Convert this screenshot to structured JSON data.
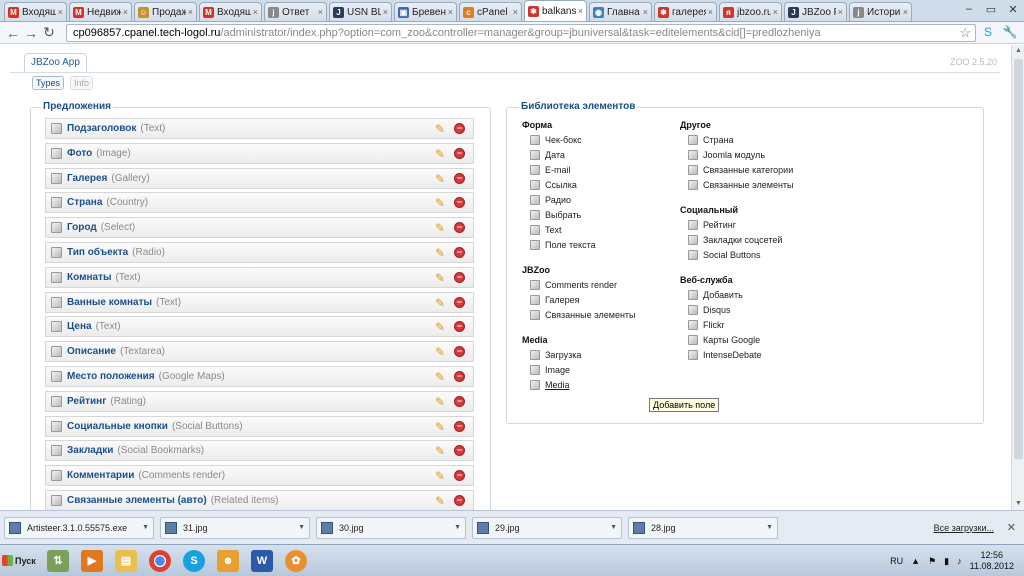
{
  "browser": {
    "tabs": [
      {
        "label": "Входящ",
        "icon": "M",
        "color": "#d93025"
      },
      {
        "label": "Недвиж",
        "icon": "M",
        "color": "#d93025"
      },
      {
        "label": "Продаж",
        "icon": "☺",
        "color": "#c8902a"
      },
      {
        "label": "Входящ",
        "icon": "M",
        "color": "#d93025"
      },
      {
        "label": "Ответ",
        "icon": "j",
        "color": "#888888"
      },
      {
        "label": "USN BL",
        "icon": "J",
        "color": "#2a3a5a"
      },
      {
        "label": "Бревен",
        "icon": "▣",
        "color": "#3a6ab0"
      },
      {
        "label": "cPanel F",
        "icon": "c",
        "color": "#e27b1f"
      },
      {
        "label": "balkans",
        "icon": "✱",
        "color": "#d0342c"
      },
      {
        "label": "Главна",
        "icon": "◉",
        "color": "#3a80c2"
      },
      {
        "label": "галерея",
        "icon": "✱",
        "color": "#d0342c"
      },
      {
        "label": "jbzoo.ru",
        "icon": "я",
        "color": "#d0342c"
      },
      {
        "label": "JBZoo F",
        "icon": "J",
        "color": "#2a3a5a"
      },
      {
        "label": "Истори",
        "icon": "j",
        "color": "#888888"
      }
    ],
    "url_host": "cp096857.cpanel.tech-logol.ru",
    "url_path": "/administrator/index.php?option=com_zoo&controller=manager&group=jbuniversal&task=editelements&cid[]=predlozheniya"
  },
  "app": {
    "tab": "JBZoo App",
    "version": "ZOO 2.5.20",
    "btn_types": "Types",
    "btn_info": "Info"
  },
  "left": {
    "legend": "Предложения",
    "elements": [
      {
        "name": "Подзаголовок",
        "type": "(Text)"
      },
      {
        "name": "Фото",
        "type": "(Image)"
      },
      {
        "name": "Галерея",
        "type": "(Gallery)"
      },
      {
        "name": "Страна",
        "type": "(Country)"
      },
      {
        "name": "Город",
        "type": "(Select)"
      },
      {
        "name": "Тип объекта",
        "type": "(Radio)"
      },
      {
        "name": "Комнаты",
        "type": "(Text)"
      },
      {
        "name": "Ванные комнаты",
        "type": "(Text)"
      },
      {
        "name": "Цена",
        "type": "(Text)"
      },
      {
        "name": "Описание",
        "type": "(Textarea)"
      },
      {
        "name": "Место положения",
        "type": "(Google Maps)"
      },
      {
        "name": "Рейтинг",
        "type": "(Rating)"
      },
      {
        "name": "Социальные кнопки",
        "type": "(Social Buttons)"
      },
      {
        "name": "Закладки",
        "type": "(Social Bookmarks)"
      },
      {
        "name": "Комментарии",
        "type": "(Comments render)"
      },
      {
        "name": "Связанные элементы (авто)",
        "type": "(Related items)"
      }
    ]
  },
  "library": {
    "legend": "Библиотека элементов",
    "col1": [
      {
        "title": "Форма",
        "items": [
          "Чек-бокс",
          "Дата",
          "E-mail",
          "Ссылка",
          "Радио",
          "Выбрать",
          "Text",
          "Поле текста"
        ]
      },
      {
        "title": "JBZoo",
        "items": [
          "Comments render",
          "Галерея",
          "Связанные элементы"
        ]
      },
      {
        "title": "Media",
        "items": [
          "Загрузка",
          "Image",
          "Media"
        ]
      }
    ],
    "col2": [
      {
        "title": "Другое",
        "items": [
          "Страна",
          "Joomla модуль",
          "Связанные категории",
          "Связанные элементы"
        ]
      },
      {
        "title": "Социальный",
        "items": [
          "Рейтинг",
          "Закладки соцсетей",
          "Social Buttons"
        ]
      },
      {
        "title": "Веб-служба",
        "items": [
          "Добавить",
          "Disqus",
          "Flickr",
          "Карты Google",
          "IntenseDebate"
        ]
      }
    ],
    "tooltip": "Добавить поле"
  },
  "downloads": {
    "items": [
      "Artisteer.3.1.0.55575.exe",
      "31.jpg",
      "30.jpg",
      "29.jpg",
      "28.jpg"
    ],
    "all": "Все загрузки..."
  },
  "taskbar": {
    "start": "Пуск",
    "lang": "RU",
    "time": "12:56",
    "date": "11.08.2012"
  }
}
